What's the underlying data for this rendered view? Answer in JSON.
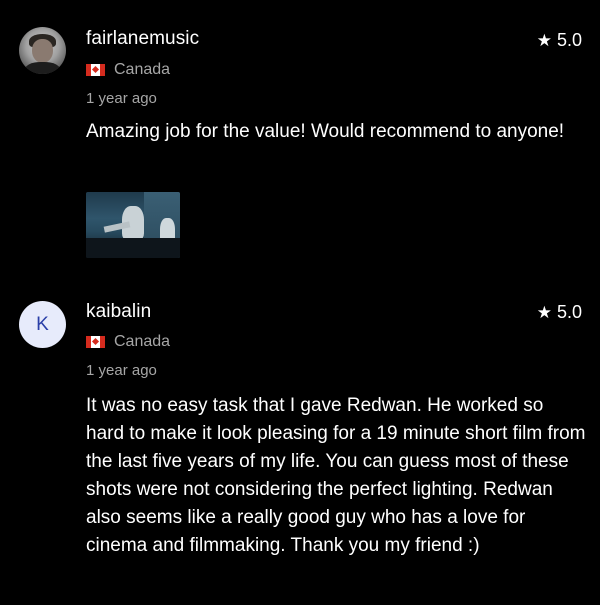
{
  "reviews": [
    {
      "username": "fairlanemusic",
      "rating": "5.0",
      "country": "Canada",
      "time": "1 year ago",
      "comment": "Amazing job for the value! Would recommend to anyone!"
    },
    {
      "username": "kaibalin",
      "avatar_letter": "K",
      "rating": "5.0",
      "country": "Canada",
      "time": "1 year ago",
      "comment": "It was no easy task that I gave Redwan. He worked so hard to make it look pleasing for a 19 minute short film from the last five years of my life. You can guess most of these shots were not considering the perfect lighting. Redwan also seems like a really good guy who has a love for cinema and filmmaking. Thank you my friend :)"
    }
  ],
  "icons": {
    "star": "star-icon",
    "flag": "canada-flag-icon"
  },
  "colors": {
    "background": "#000000",
    "text": "#ffffff",
    "muted": "#a6a6a6",
    "avatar_bg": "#e7ebfb",
    "avatar_letter": "#2a3fa8",
    "flag_red": "#d52b1e"
  }
}
